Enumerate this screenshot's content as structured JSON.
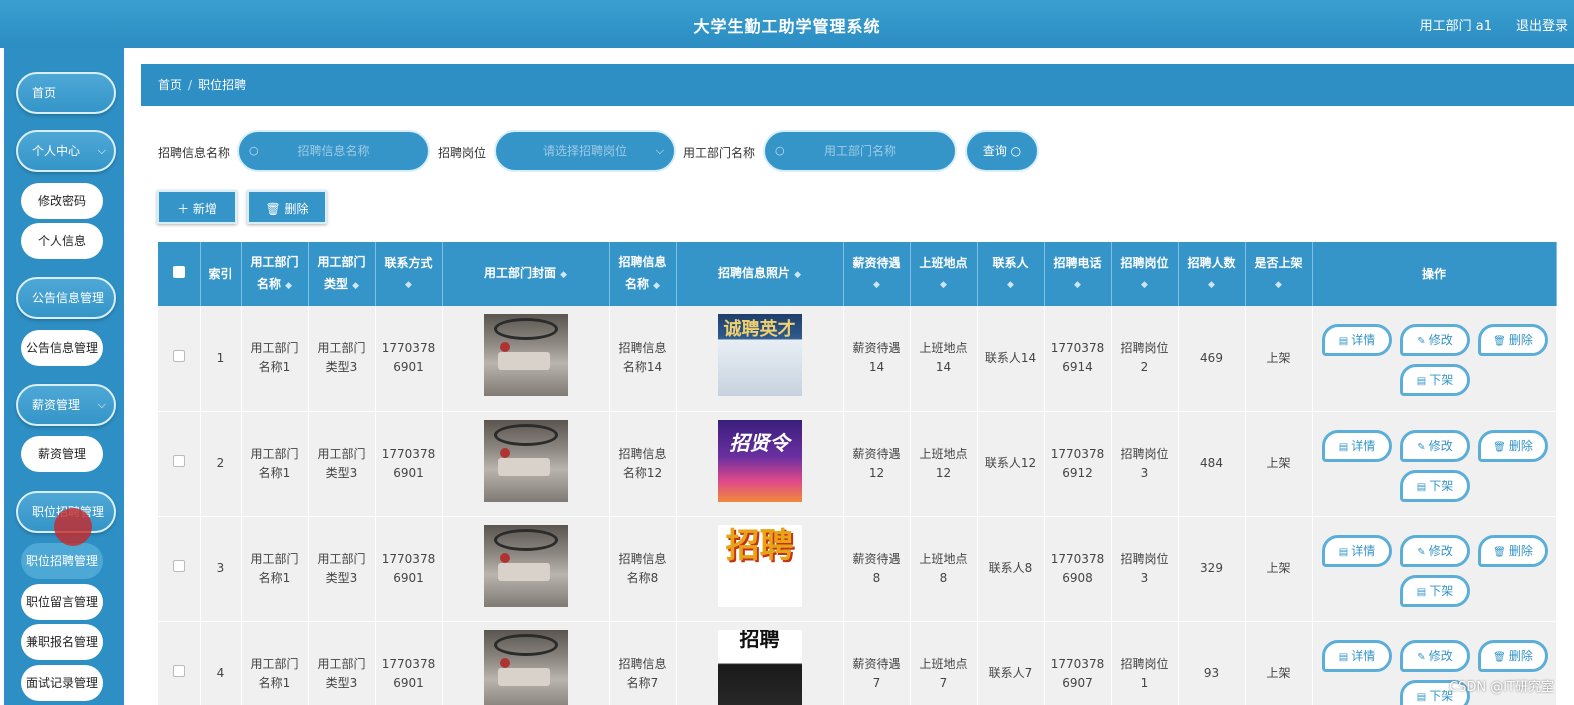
{
  "header": {
    "title": "大学生勤工助学管理系统",
    "user": "用工部门 a1",
    "logout": "退出登录"
  },
  "sidebar": {
    "home": "首页",
    "personal_center": "个人中心",
    "change_password": "修改密码",
    "personal_info": "个人信息",
    "notice_mgmt_group": "公告信息管理",
    "notice_mgmt": "公告信息管理",
    "salary_group": "薪资管理",
    "salary_mgmt": "薪资管理",
    "job_recruit_group": "职位招聘管理",
    "job_recruit_mgmt": "职位招聘管理",
    "job_message_mgmt": "职位留言管理",
    "parttime_signup_mgmt": "兼职报名管理",
    "interview_mgmt": "面试记录管理"
  },
  "breadcrumb": {
    "home": "首页",
    "sep": "/",
    "current": "职位招聘"
  },
  "search": {
    "name_label": "招聘信息名称",
    "name_placeholder": "招聘信息名称",
    "post_label": "招聘岗位",
    "post_placeholder": "请选择招聘岗位",
    "dept_label": "用工部门名称",
    "dept_placeholder": "用工部门名称",
    "query": "查询"
  },
  "actions": {
    "add": "新增",
    "delete": "删除"
  },
  "table": {
    "headers": {
      "index": "索引",
      "dept_name": [
        "用工部门",
        "名称"
      ],
      "dept_type": [
        "用工部门",
        "类型"
      ],
      "contact": [
        "联系方式"
      ],
      "cover": "用工部门封面",
      "info_name": [
        "招聘信息",
        "名称"
      ],
      "photo": "招聘信息照片",
      "salary": [
        "薪资待遇"
      ],
      "location": [
        "上班地点"
      ],
      "contact_person": "联系人",
      "phone": "招聘电话",
      "post": "招聘岗位",
      "count": "招聘人数",
      "listed": "是否上架",
      "ops": "操作"
    },
    "rows": [
      {
        "index": "1",
        "dept_name": [
          "用工部门",
          "名称1"
        ],
        "dept_type": [
          "用工部门",
          "类型3"
        ],
        "contact": [
          "1770378",
          "6901"
        ],
        "info_name": [
          "招聘信息",
          "名称14"
        ],
        "photo_text": "诚聘英才",
        "salary": [
          "薪资待遇",
          "14"
        ],
        "location": [
          "上班地点",
          "14"
        ],
        "contact_person": "联系人14",
        "phone": [
          "1770378",
          "6914"
        ],
        "post": [
          "招聘岗位",
          "2"
        ],
        "count": "469",
        "listed": "上架"
      },
      {
        "index": "2",
        "dept_name": [
          "用工部门",
          "名称1"
        ],
        "dept_type": [
          "用工部门",
          "类型3"
        ],
        "contact": [
          "1770378",
          "6901"
        ],
        "info_name": [
          "招聘信息",
          "名称12"
        ],
        "photo_text": "招贤令",
        "salary": [
          "薪资待遇",
          "12"
        ],
        "location": [
          "上班地点",
          "12"
        ],
        "contact_person": "联系人12",
        "phone": [
          "1770378",
          "6912"
        ],
        "post": [
          "招聘岗位",
          "3"
        ],
        "count": "484",
        "listed": "上架"
      },
      {
        "index": "3",
        "dept_name": [
          "用工部门",
          "名称1"
        ],
        "dept_type": [
          "用工部门",
          "类型3"
        ],
        "contact": [
          "1770378",
          "6901"
        ],
        "info_name": [
          "招聘信息",
          "名称8"
        ],
        "photo_text": "招聘",
        "salary": [
          "薪资待遇",
          "8"
        ],
        "location": [
          "上班地点",
          "8"
        ],
        "contact_person": "联系人8",
        "phone": [
          "1770378",
          "6908"
        ],
        "post": [
          "招聘岗位",
          "3"
        ],
        "count": "329",
        "listed": "上架"
      },
      {
        "index": "4",
        "dept_name": [
          "用工部门",
          "名称1"
        ],
        "dept_type": [
          "用工部门",
          "类型3"
        ],
        "contact": [
          "1770378",
          "6901"
        ],
        "info_name": [
          "招聘信息",
          "名称7"
        ],
        "photo_text": "招聘",
        "salary": [
          "薪资待遇",
          "7"
        ],
        "location": [
          "上班地点",
          "7"
        ],
        "contact_person": "联系人7",
        "phone": [
          "1770378",
          "6907"
        ],
        "post": [
          "招聘岗位",
          "1"
        ],
        "count": "93",
        "listed": "上架"
      }
    ],
    "row_ops": {
      "detail": "详情",
      "edit": "修改",
      "delete": "删除",
      "unlist": "下架"
    }
  },
  "watermark": "CSDN @IT研究室",
  "colors": {
    "primary": "#3595c8",
    "header": "#2b8dc2",
    "row_bg": "#f0f0f0"
  }
}
